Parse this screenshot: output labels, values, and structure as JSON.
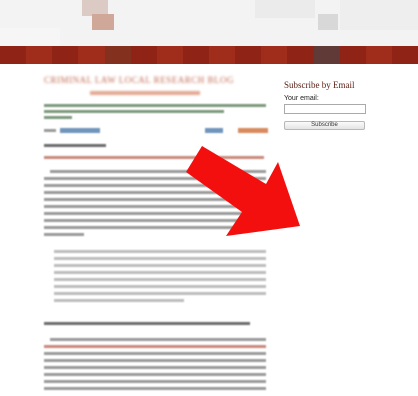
{
  "header": {
    "article_title": "CRIMINAL LAW LOCAL RESEARCH BLOG"
  },
  "sidebar": {
    "title": "Subscribe by Email",
    "email_label": "Your email:",
    "email_value": "",
    "subscribe_label": "Subscribe"
  },
  "colors": {
    "nav_bar": "#962718",
    "arrow": "#f40f0f",
    "sidebar_title": "#5b2016"
  },
  "icons": {
    "annotation": "red-arrow-icon"
  }
}
